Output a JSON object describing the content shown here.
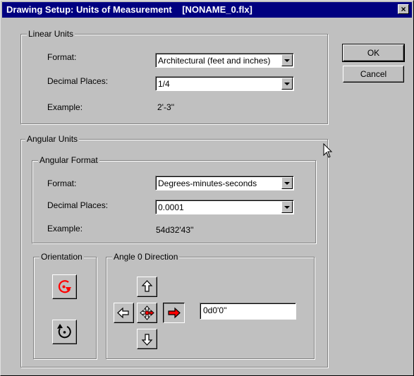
{
  "window": {
    "title": "Drawing Setup: Units of Measurement    [NONAME_0.flx]",
    "close_glyph": "×"
  },
  "buttons": {
    "ok": "OK",
    "cancel": "Cancel"
  },
  "linear_units": {
    "group_label": "Linear Units",
    "format_label": "Format:",
    "format_value": "Architectural (feet and inches)",
    "decimal_label": "Decimal Places:",
    "decimal_value": "1/4",
    "example_label": "Example:",
    "example_value": "2'-3''"
  },
  "angular_units": {
    "group_label": "Angular Units",
    "angular_format": {
      "group_label": "Angular Format",
      "format_label": "Format:",
      "format_value": "Degrees-minutes-seconds",
      "decimal_label": "Decimal Places:",
      "decimal_value": "0.0001",
      "example_label": "Example:",
      "example_value": "54d32'43''"
    },
    "orientation": {
      "group_label": "Orientation",
      "selected": "clockwise",
      "icons": [
        "clockwise-rotation-icon",
        "counterclockwise-rotation-icon"
      ]
    },
    "angle_zero": {
      "group_label": "Angle 0 Direction",
      "selected": "east",
      "direction_icons": [
        "arrow-up-icon",
        "arrow-left-icon",
        "center-icon",
        "arrow-right-icon",
        "arrow-down-icon"
      ],
      "value": "0d0'0''"
    }
  },
  "colors": {
    "title_bar": "#000080",
    "face": "#c0c0c0",
    "accent_red": "#ff0000"
  }
}
